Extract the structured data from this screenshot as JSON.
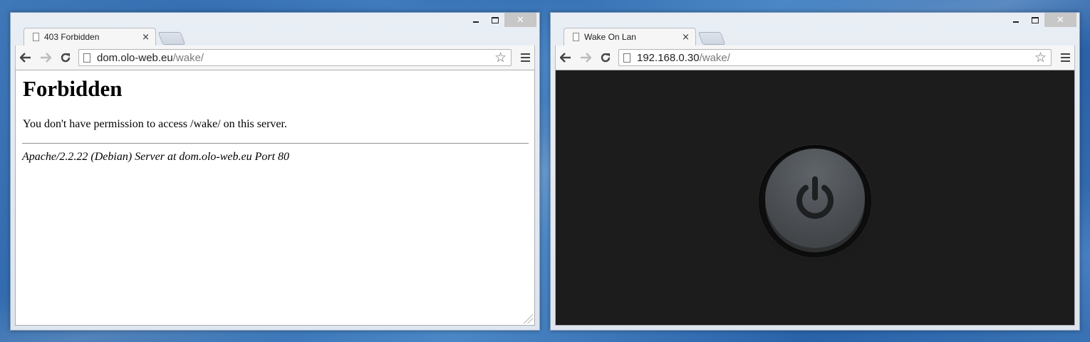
{
  "windows": [
    {
      "tab": {
        "title": "403 Forbidden",
        "close": "×"
      },
      "address": {
        "host": "dom.olo-web.eu",
        "path": "/wake/"
      },
      "controls": {
        "close": "✕"
      },
      "page": {
        "title": "Forbidden",
        "message": "You don't have permission to access /wake/ on this server.",
        "server_signature": "Apache/2.2.22 (Debian) Server at dom.olo-web.eu Port 80"
      }
    },
    {
      "tab": {
        "title": "Wake On Lan",
        "close": "×"
      },
      "address": {
        "host": "192.168.0.30",
        "path": "/wake/"
      },
      "controls": {
        "close": "✕"
      },
      "page": {
        "power_icon": "power-icon"
      }
    }
  ],
  "icons": {
    "star": "☆",
    "back": "back-arrow-icon",
    "forward": "forward-arrow-icon",
    "reload": "reload-icon",
    "menu": "hamburger-menu-icon"
  },
  "colors": {
    "dark_page_bg": "#1c1c1c",
    "power_button": "#4a4e52",
    "power_symbol": "#1e1f20"
  }
}
